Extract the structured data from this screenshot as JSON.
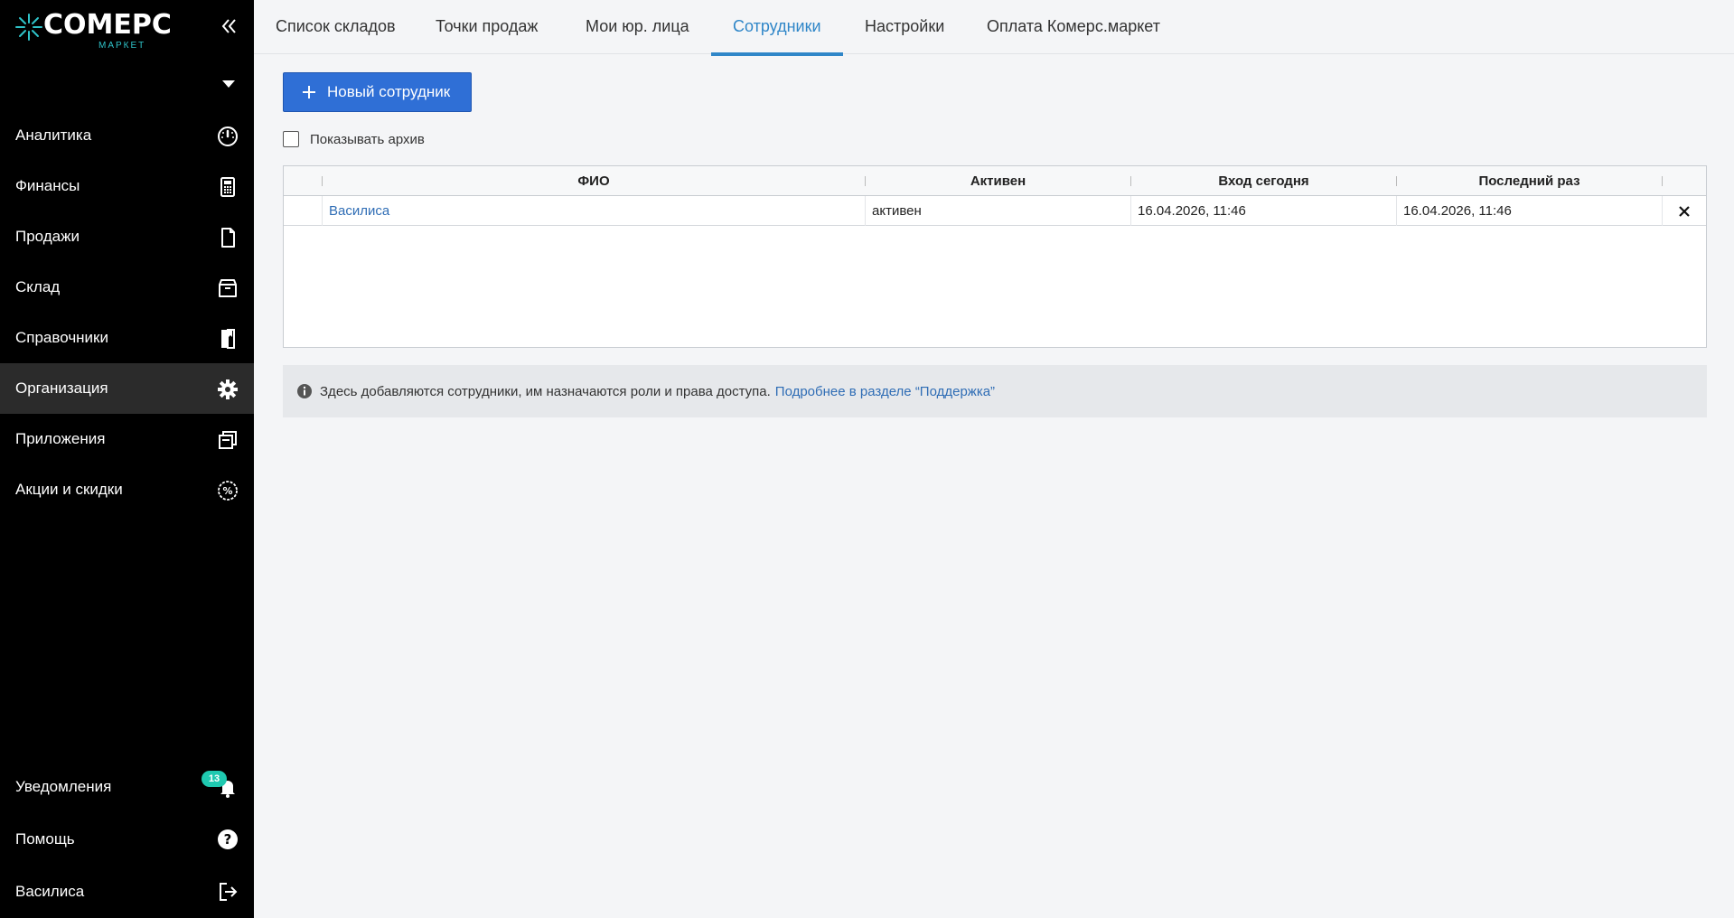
{
  "brand": {
    "name": "COMEPC",
    "subtitle": "МАРКЕТ",
    "accent": "#2fc3c9"
  },
  "sidebar": {
    "items": [
      {
        "label": "Аналитика",
        "icon": "speedometer-icon"
      },
      {
        "label": "Финансы",
        "icon": "calculator-icon"
      },
      {
        "label": "Продажи",
        "icon": "document-icon"
      },
      {
        "label": "Склад",
        "icon": "box-icon"
      },
      {
        "label": "Справочники",
        "icon": "book-icon"
      },
      {
        "label": "Организация",
        "icon": "gear-icon",
        "active": true
      },
      {
        "label": "Приложения",
        "icon": "apps-icon"
      },
      {
        "label": "Акции и скидки",
        "icon": "percent-icon"
      }
    ],
    "bottom": {
      "notifications": {
        "label": "Уведомления",
        "badge": "13"
      },
      "help": {
        "label": "Помощь"
      },
      "user": {
        "label": "Василиса"
      }
    }
  },
  "tabs": [
    {
      "label": "Список складов"
    },
    {
      "label": "Точки продаж"
    },
    {
      "label": "Мои юр. лица"
    },
    {
      "label": "Сотрудники",
      "active": true
    },
    {
      "label": "Настройки"
    },
    {
      "label": "Оплата Комерс.маркет"
    }
  ],
  "toolbar": {
    "new_employee_label": "Новый сотрудник",
    "show_archive_label": "Показывать архив",
    "show_archive_checked": false
  },
  "table": {
    "columns": [
      "ФИО",
      "Активен",
      "Вход сегодня",
      "Последний раз"
    ],
    "rows": [
      {
        "name": "Василиса",
        "active": "активен",
        "login_today": "16.04.2026, 11:46",
        "last_seen": "16.04.2026, 11:46"
      }
    ]
  },
  "info": {
    "text": "Здесь добавляются сотрудники, им назначаются роли и права доступа.",
    "link": "Подробнее в разделе “Поддержка”"
  },
  "colors": {
    "primary": "#2f6fd6",
    "active_tab": "#2f86c8",
    "link": "#2f6db5",
    "badge": "#1fc9b0"
  }
}
